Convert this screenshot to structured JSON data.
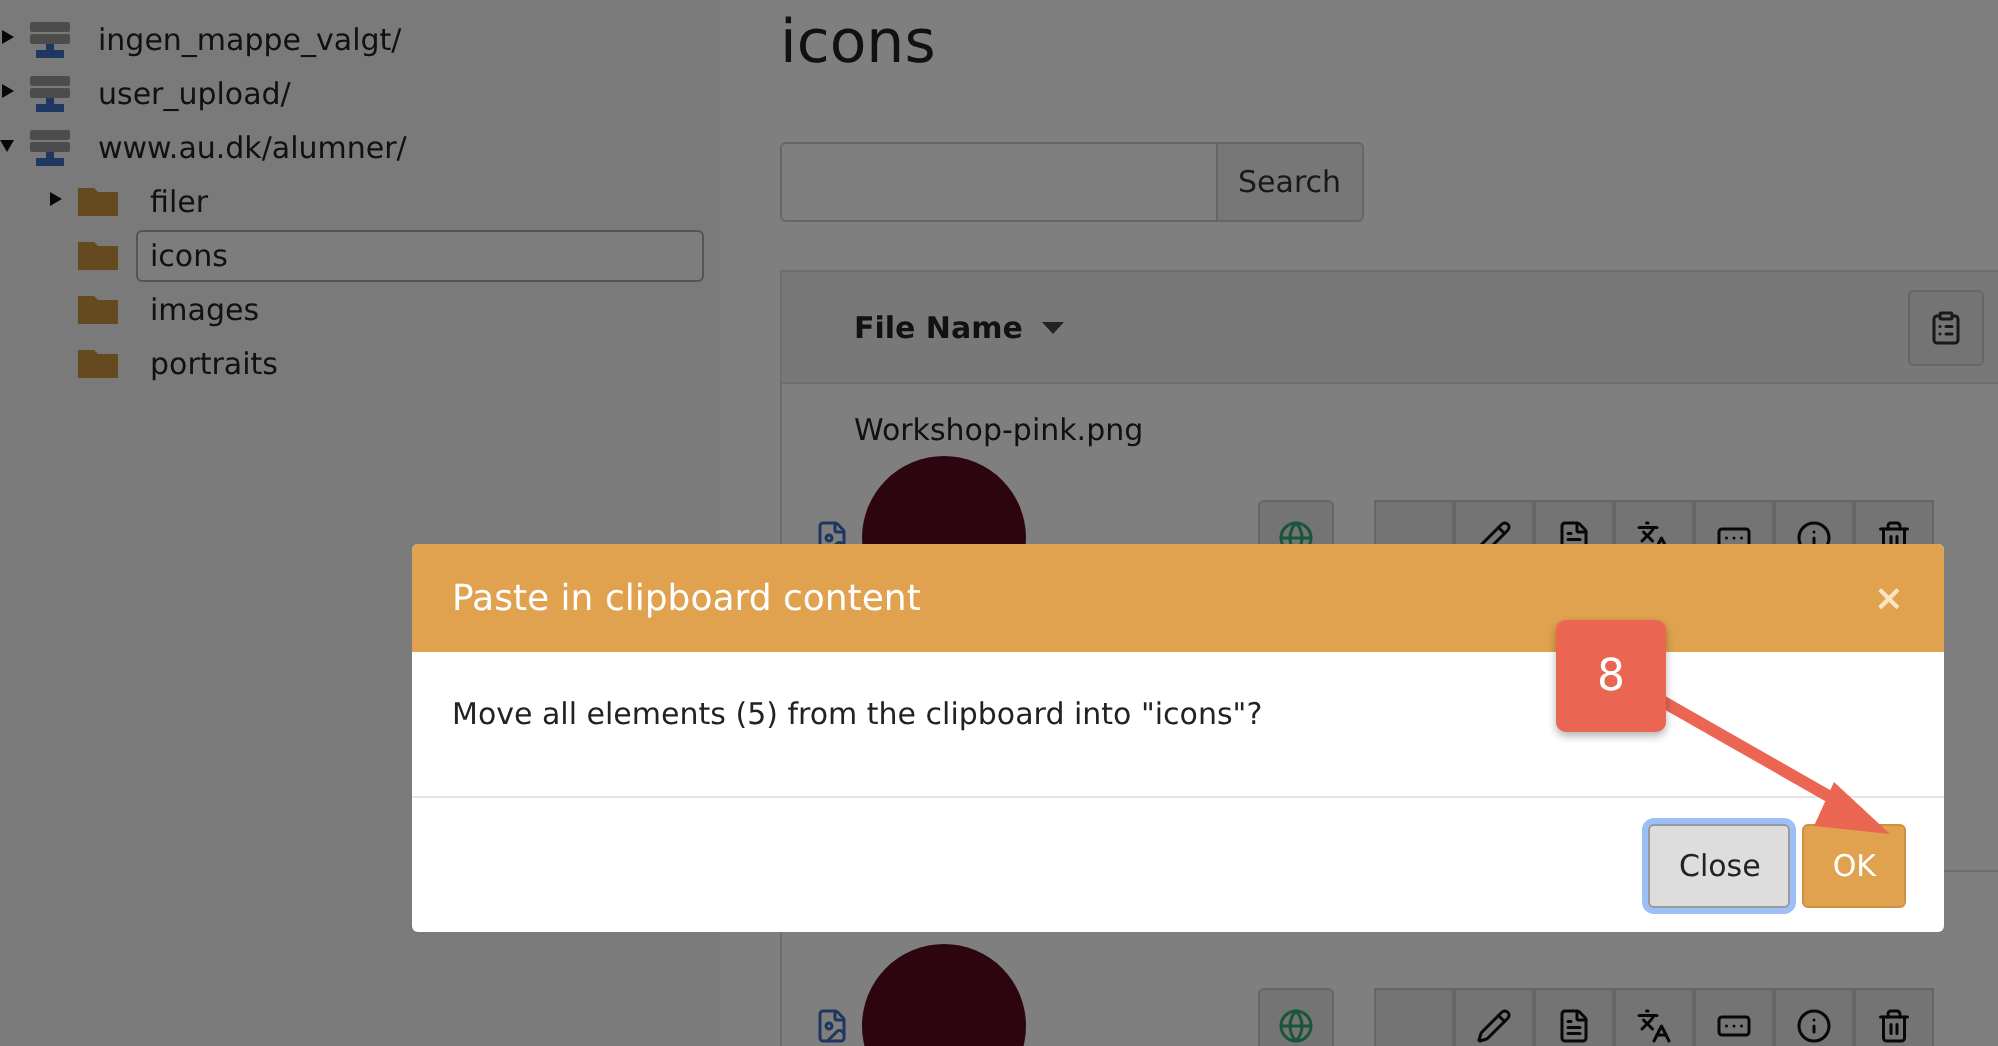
{
  "tree": [
    {
      "label": "ingen_mappe_valgt/",
      "kind": "server",
      "expanded": false,
      "selected": false
    },
    {
      "label": "user_upload/",
      "kind": "server",
      "expanded": false,
      "selected": false
    },
    {
      "label": "www.au.dk/alumner/",
      "kind": "server",
      "expanded": true,
      "selected": false,
      "children": [
        {
          "label": "filer",
          "kind": "folder",
          "expanded": false,
          "selected": false
        },
        {
          "label": "icons",
          "kind": "folder",
          "selected": true
        },
        {
          "label": "images",
          "kind": "folder",
          "selected": false
        },
        {
          "label": "portraits",
          "kind": "folder",
          "selected": false
        }
      ]
    }
  ],
  "page_title": "icons",
  "search": {
    "button": "Search"
  },
  "table": {
    "column": "File Name",
    "rows": [
      {
        "kind": "named",
        "name": "Workshop-pink.png"
      },
      {
        "kind": "covered"
      }
    ]
  },
  "dialog": {
    "title": "Paste in clipboard content",
    "close_glyph": "×",
    "message": "Move all elements (5) from the clipboard into \"icons\"?",
    "buttons": [
      {
        "label": "Close",
        "kind": "secondary",
        "focused": true
      },
      {
        "label": "OK",
        "kind": "primary",
        "focused": false
      }
    ]
  },
  "annotation": {
    "label": "8"
  }
}
